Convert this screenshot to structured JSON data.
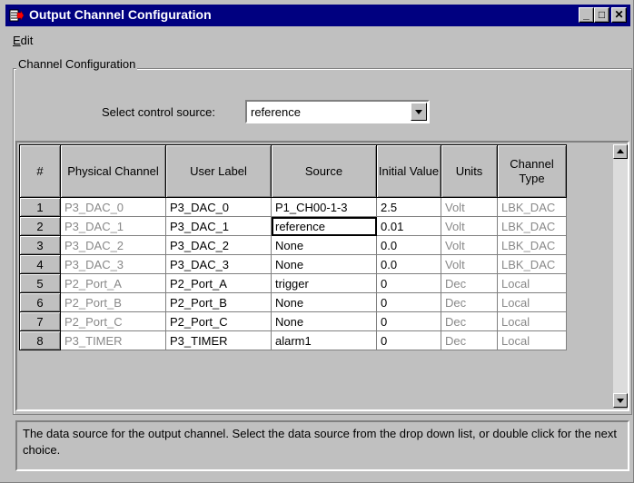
{
  "window": {
    "title": "Output Channel Configuration",
    "minimize_label": "_",
    "maximize_label": "□",
    "close_label": "✕",
    "icon": "app-arrow-icon",
    "titlebar_color": "#000080"
  },
  "menu": {
    "edit_label_first": "E",
    "edit_label_rest": "dit"
  },
  "group": {
    "title": "Channel Configuration"
  },
  "control_source": {
    "label": "Select control source:",
    "value": "reference"
  },
  "table": {
    "headers": [
      "#",
      "Physical Channel",
      "User Label",
      "Source",
      "Initial Value",
      "Units",
      "Channel Type"
    ],
    "rows": [
      {
        "num": "1",
        "physical": "P3_DAC_0",
        "label": "P3_DAC_0",
        "source": "P1_CH00-1-3",
        "initial": "2.5",
        "units": "Volt",
        "type": "LBK_DAC"
      },
      {
        "num": "2",
        "physical": "P3_DAC_1",
        "label": "P3_DAC_1",
        "source": "reference",
        "initial": "0.01",
        "units": "Volt",
        "type": "LBK_DAC"
      },
      {
        "num": "3",
        "physical": "P3_DAC_2",
        "label": "P3_DAC_2",
        "source": "None",
        "initial": "0.0",
        "units": "Volt",
        "type": "LBK_DAC"
      },
      {
        "num": "4",
        "physical": "P3_DAC_3",
        "label": "P3_DAC_3",
        "source": "None",
        "initial": "0.0",
        "units": "Volt",
        "type": "LBK_DAC"
      },
      {
        "num": "5",
        "physical": "P2_Port_A",
        "label": "P2_Port_A",
        "source": "trigger",
        "initial": "0",
        "units": "Dec",
        "type": "Local"
      },
      {
        "num": "6",
        "physical": "P2_Port_B",
        "label": "P2_Port_B",
        "source": "None",
        "initial": "0",
        "units": "Dec",
        "type": "Local"
      },
      {
        "num": "7",
        "physical": "P2_Port_C",
        "label": "P2_Port_C",
        "source": "None",
        "initial": "0",
        "units": "Dec",
        "type": "Local"
      },
      {
        "num": "8",
        "physical": "P3_TIMER",
        "label": "P3_TIMER",
        "source": "alarm1",
        "initial": "0",
        "units": "Dec",
        "type": "Local"
      }
    ],
    "selected_row": 2,
    "selected_column": "source"
  },
  "status": {
    "text": "The data source for the output channel. Select the data source from the drop down list, or double click for the next choice."
  }
}
